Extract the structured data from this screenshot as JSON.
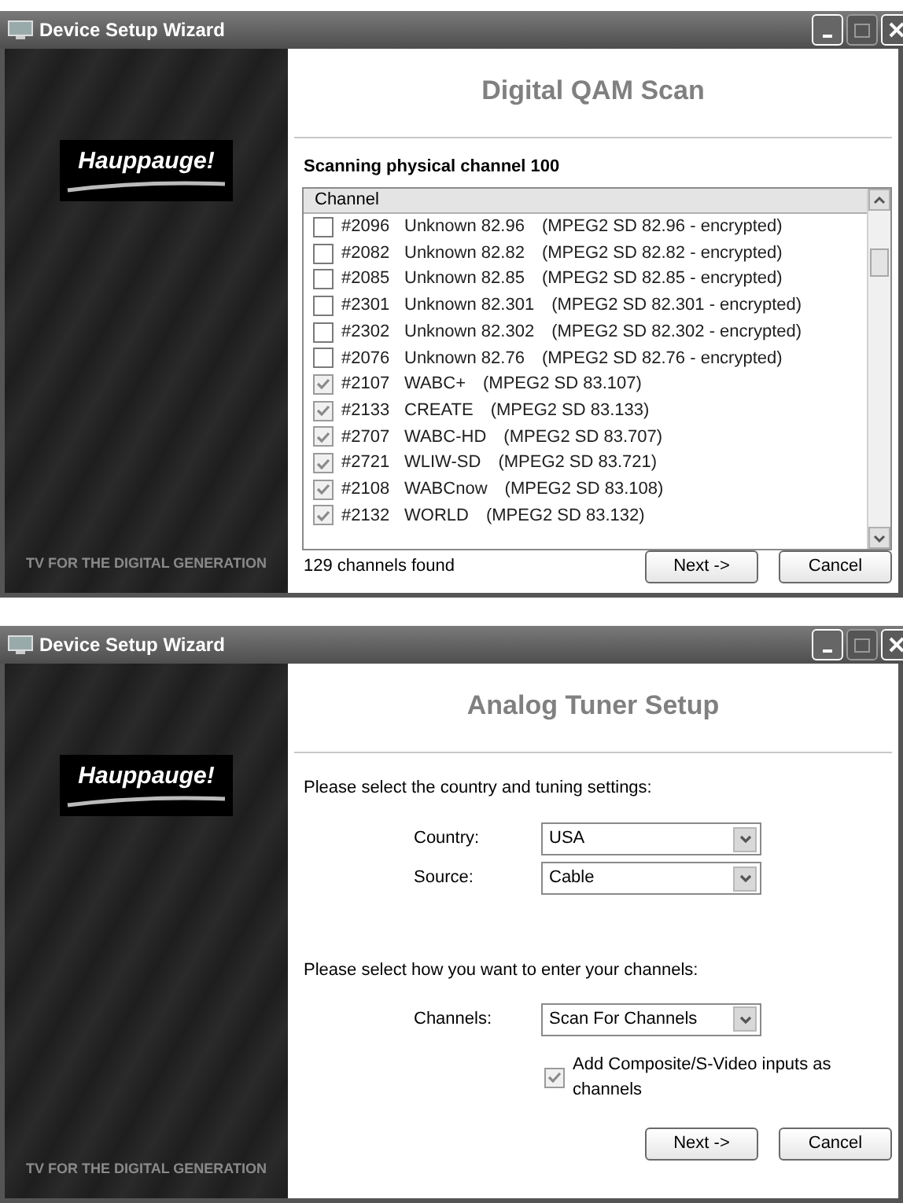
{
  "windows": [
    {
      "title": "Device Setup Wizard",
      "brand": "Hauppauge!",
      "tagline": "TV FOR THE DIGITAL GENERATION",
      "page": {
        "kind": "scan",
        "heading": "Digital QAM Scan",
        "status": "Scanning physical channel 100",
        "column": "Channel",
        "rows": [
          {
            "number": "#2096",
            "name": "Unknown 82.96",
            "info": "(MPEG2 SD 82.96 - encrypted)",
            "checked": false
          },
          {
            "number": "#2082",
            "name": "Unknown 82.82",
            "info": "(MPEG2 SD 82.82 - encrypted)",
            "checked": false
          },
          {
            "number": "#2085",
            "name": "Unknown 82.85",
            "info": "(MPEG2 SD 82.85 - encrypted)",
            "checked": false
          },
          {
            "number": "#2301",
            "name": "Unknown 82.301",
            "info": "(MPEG2 SD 82.301 - encrypted)",
            "checked": false
          },
          {
            "number": "#2302",
            "name": "Unknown 82.302",
            "info": "(MPEG2 SD 82.302 - encrypted)",
            "checked": false
          },
          {
            "number": "#2076",
            "name": "Unknown 82.76",
            "info": "(MPEG2 SD 82.76 - encrypted)",
            "checked": false
          },
          {
            "number": "#2107",
            "name": "WABC+",
            "info": "(MPEG2 SD 83.107)",
            "checked": true
          },
          {
            "number": "#2133",
            "name": "CREATE",
            "info": "(MPEG2 SD 83.133)",
            "checked": true
          },
          {
            "number": "#2707",
            "name": "WABC-HD",
            "info": "(MPEG2 SD 83.707)",
            "checked": true
          },
          {
            "number": "#2721",
            "name": "WLIW-SD",
            "info": "(MPEG2 SD 83.721)",
            "checked": true
          },
          {
            "number": "#2108",
            "name": "WABCnow",
            "info": "(MPEG2 SD 83.108)",
            "checked": true
          },
          {
            "number": "#2132",
            "name": "WORLD",
            "info": "(MPEG2 SD 83.132)",
            "checked": true
          }
        ],
        "found": "129 channels found"
      },
      "buttons": [
        "Next ->",
        "Cancel"
      ]
    },
    {
      "title": "Device Setup Wizard",
      "brand": "Hauppauge!",
      "tagline": "TV FOR THE DIGITAL GENERATION",
      "page": {
        "kind": "tuner",
        "heading": "Analog Tuner Setup",
        "intro": "Please select the country and tuning settings:",
        "fields": [
          {
            "label": "Country:",
            "value": "USA"
          },
          {
            "label": "Source:",
            "value": "Cable"
          }
        ],
        "prompt": "Please select how you want to enter your channels:",
        "channel_field": {
          "label": "Channels:",
          "value": "Scan For Channels"
        },
        "option": {
          "label": "Add Composite/S-Video inputs as channels",
          "checked": true
        }
      },
      "buttons": [
        "Next ->",
        "Cancel"
      ]
    }
  ]
}
